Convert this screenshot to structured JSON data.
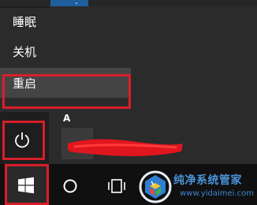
{
  "power_menu": {
    "items": [
      {
        "label": "睡眠"
      },
      {
        "label": "关机"
      },
      {
        "label": "重启"
      }
    ]
  },
  "app_list": {
    "letter": "A"
  },
  "watermark": {
    "brand": "纯净系统管家",
    "url": "www.yidaimei.com"
  },
  "colors": {
    "highlight_border": "#d81e2a",
    "menu_bg": "#2b2b2b",
    "taskbar_bg": "#101010",
    "watermark_blue": "#4a93d8"
  },
  "icons": [
    "power-icon",
    "windows-logo-icon",
    "cortana-circle-icon",
    "task-view-icon"
  ]
}
